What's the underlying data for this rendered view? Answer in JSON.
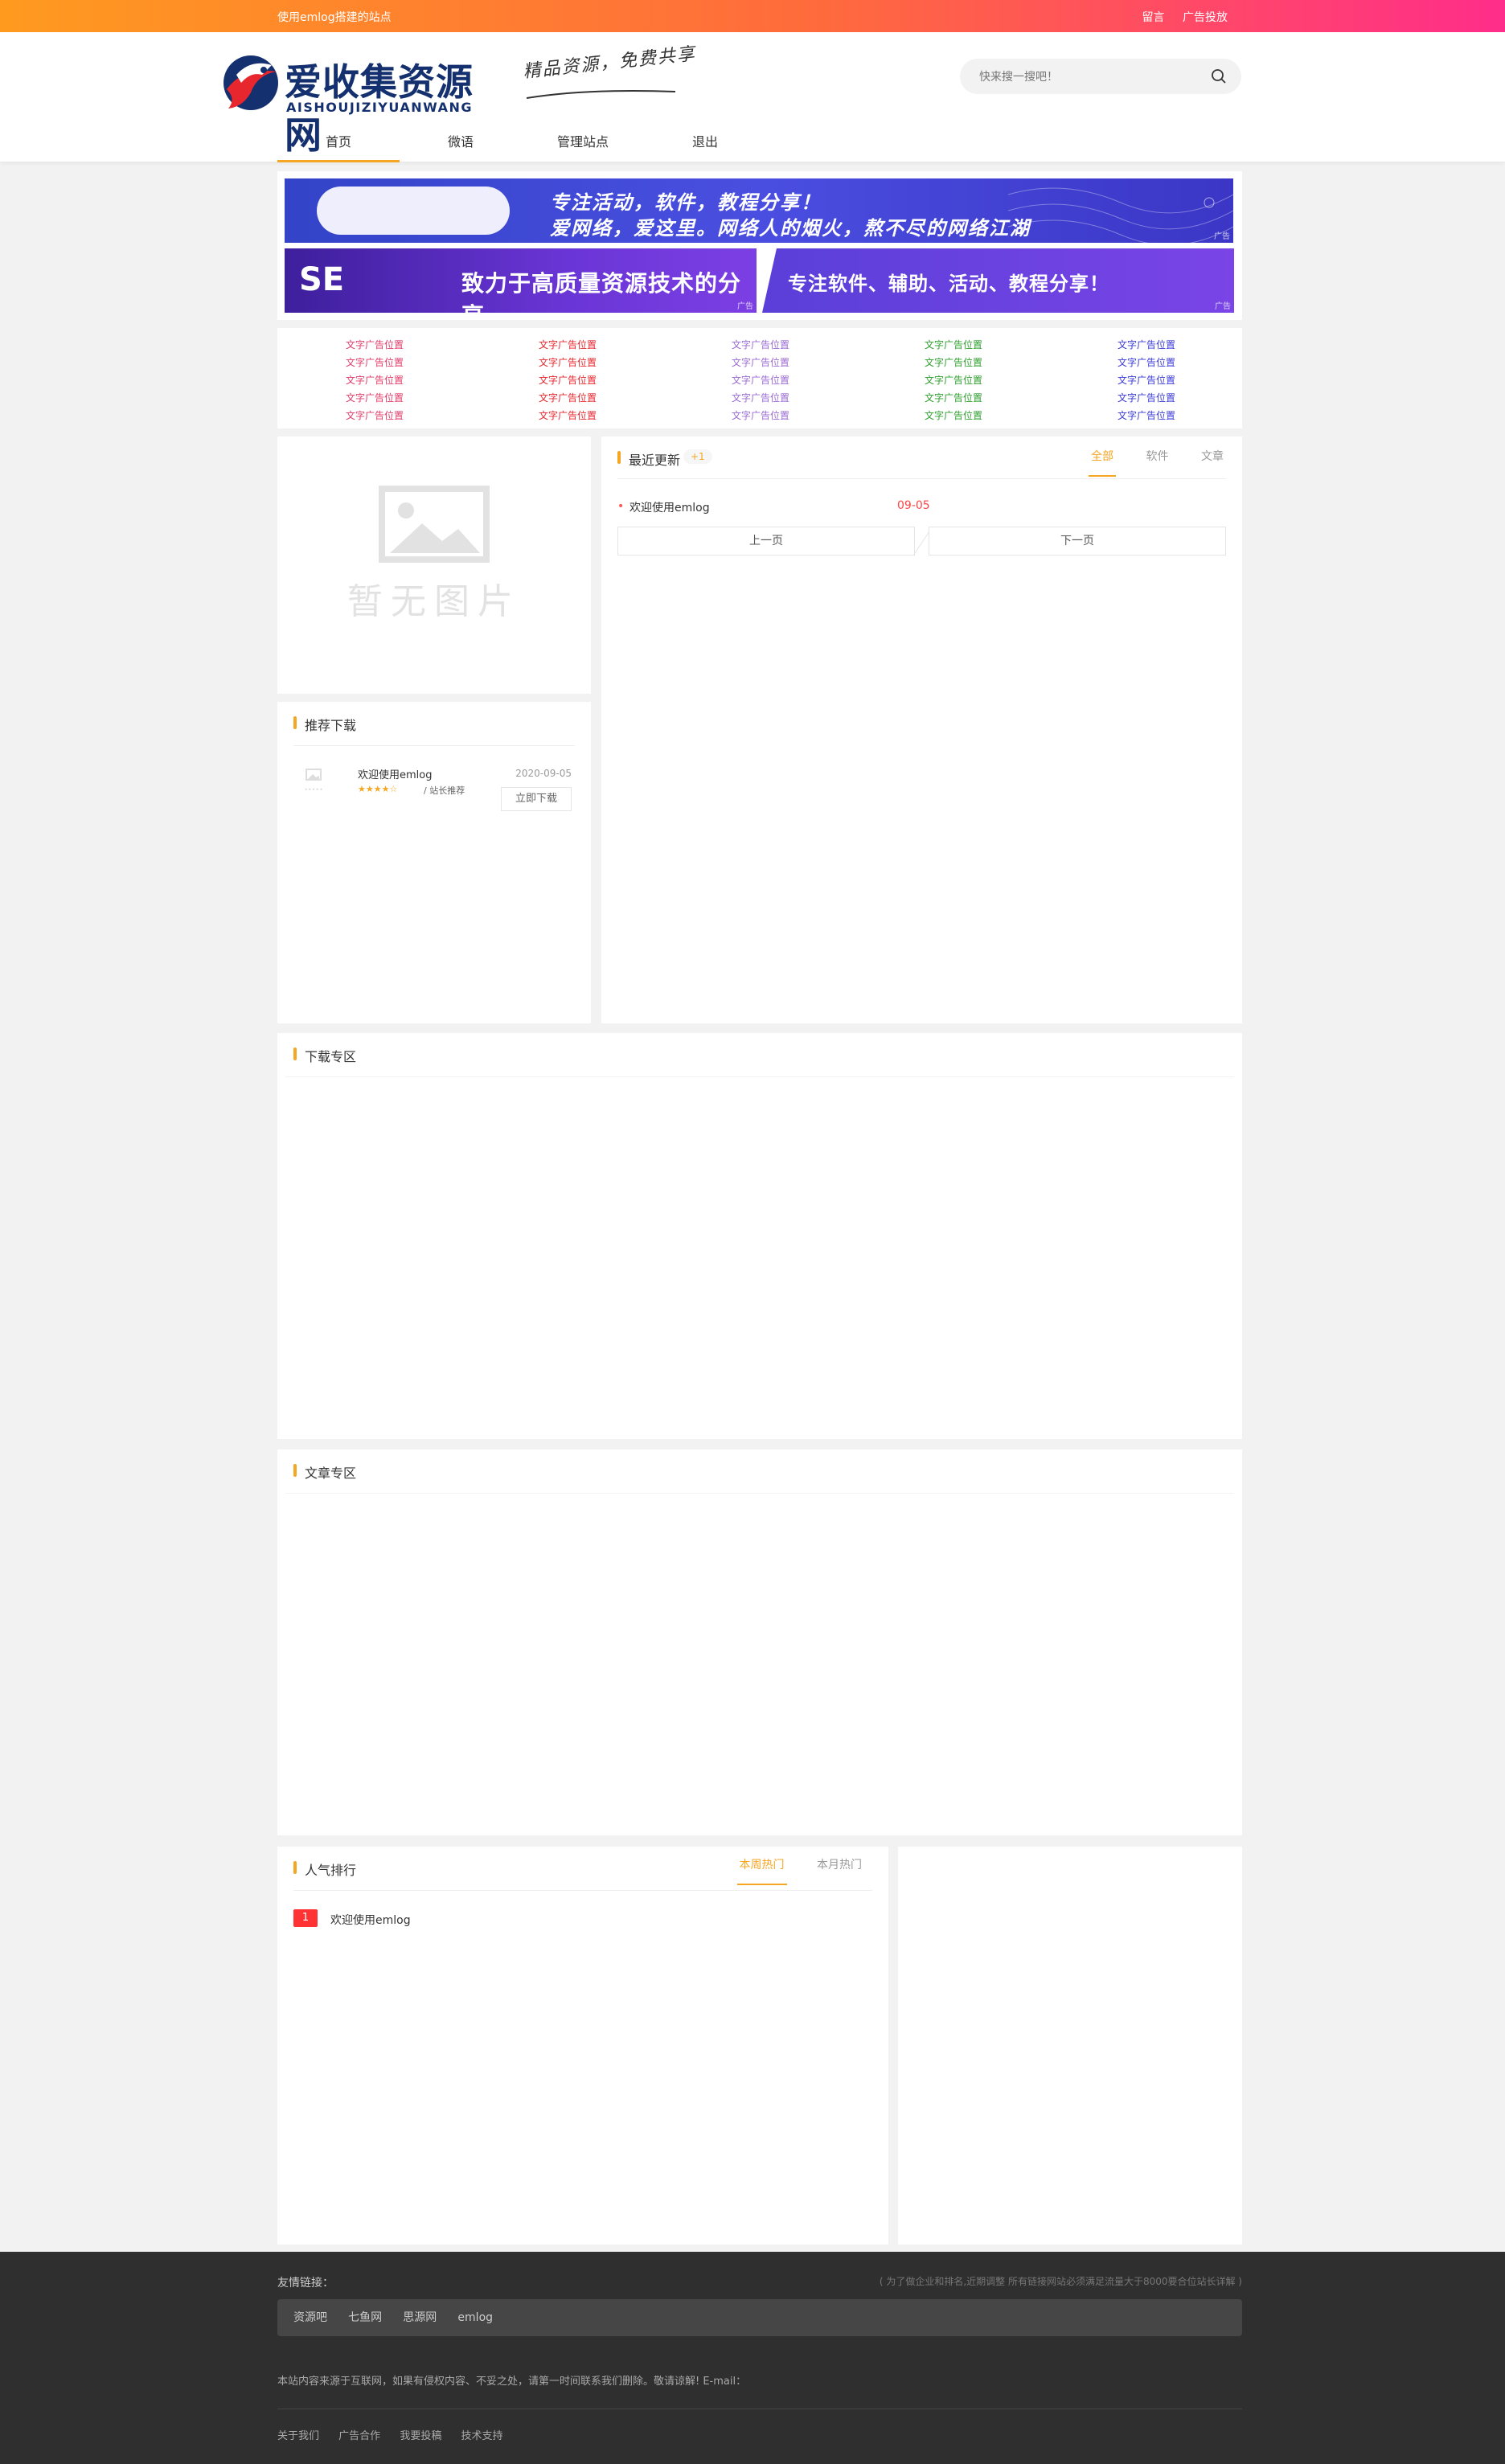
{
  "topbar": {
    "site_note": "使用emlog搭建的站点",
    "links": [
      "留言",
      "广告投放"
    ]
  },
  "header": {
    "logo_cn": "爱收集资源网",
    "logo_en": "AISHOUJIZIYUANWANG",
    "slogan": "精品资源，免费共享",
    "search_placeholder": "快来搜一搜吧！",
    "nav": [
      "首页",
      "微语",
      "管理站点",
      "退出"
    ],
    "active_nav": "首页"
  },
  "banners": {
    "banner1_line1": "专注活动，软件，教程分享！",
    "banner1_line2": "爱网络，爱这里。网络人的烟火，熬不尽的网络江湖",
    "banner2_text": "致力于高质量资源技术的分享",
    "banner2_logo": "SE",
    "banner3_text": "专注软件、辅助、活动、教程分享！",
    "ad_tag": "广告"
  },
  "text_ads": {
    "label": "文字广告位置",
    "columns": [
      {
        "color": "#e23c6a",
        "items": [
          "文字广告位置",
          "文字广告位置",
          "文字广告位置",
          "文字广告位置",
          "文字广告位置"
        ]
      },
      {
        "color": "#e8262d",
        "items": [
          "文字广告位置",
          "文字广告位置",
          "文字广告位置",
          "文字广告位置",
          "文字广告位置"
        ]
      },
      {
        "color": "#9b6bd4",
        "items": [
          "文字广告位置",
          "文字广告位置",
          "文字广告位置",
          "文字广告位置",
          "文字广告位置"
        ]
      },
      {
        "color": "#2ea02e",
        "items": [
          "文字广告位置",
          "文字广告位置",
          "文字广告位置",
          "文字广告位置",
          "文字广告位置"
        ]
      },
      {
        "color": "#3a3ad8",
        "items": [
          "文字广告位置",
          "文字广告位置",
          "文字广告位置",
          "文字广告位置",
          "文字广告位置"
        ]
      }
    ]
  },
  "placeholder_image": {
    "text": "暂无图片"
  },
  "latest": {
    "title": "最近更新",
    "badge": "+1",
    "tabs": [
      "全部",
      "软件",
      "文章"
    ],
    "active_tab": "全部",
    "items": [
      {
        "title": "欢迎使用emlog",
        "date": "09-05"
      }
    ],
    "prev": "上一页",
    "next": "下一页"
  },
  "recommend": {
    "title": "推荐下载",
    "items": [
      {
        "title": "欢迎使用emlog",
        "stars": "★★★★☆",
        "tag": "/ 站长推荐",
        "date": "2020-09-05",
        "button": "立即下载"
      }
    ]
  },
  "download_zone": {
    "title": "下载专区"
  },
  "article_zone": {
    "title": "文章专区"
  },
  "popular": {
    "title": "人气排行",
    "tabs": [
      "本周热门",
      "本月热门"
    ],
    "active_tab": "本周热门",
    "items": [
      {
        "rank": "1",
        "title": "欢迎使用emlog"
      }
    ]
  },
  "footer": {
    "friend_links_title": "友情链接：",
    "friend_links_note": "( 为了做企业和排名,近期调整 所有链接网站必须满足流量大于8000要合位站长详解 )",
    "friend_links": [
      "资源吧",
      "七鱼网",
      "思源网",
      "emlog"
    ],
    "copyright": "本站内容来源于互联网，如果有侵权内容、不妥之处，请第一时间联系我们删除。敬请谅解! E-mail：",
    "bottom_links": [
      "关于我们",
      "广告合作",
      "我要投稿",
      "技术支持"
    ]
  },
  "colors": {
    "accent": "#f5a623",
    "topbar_start": "#ff9a1f",
    "topbar_end": "#ff2d8a",
    "footer_bg": "#2f2f2f"
  }
}
